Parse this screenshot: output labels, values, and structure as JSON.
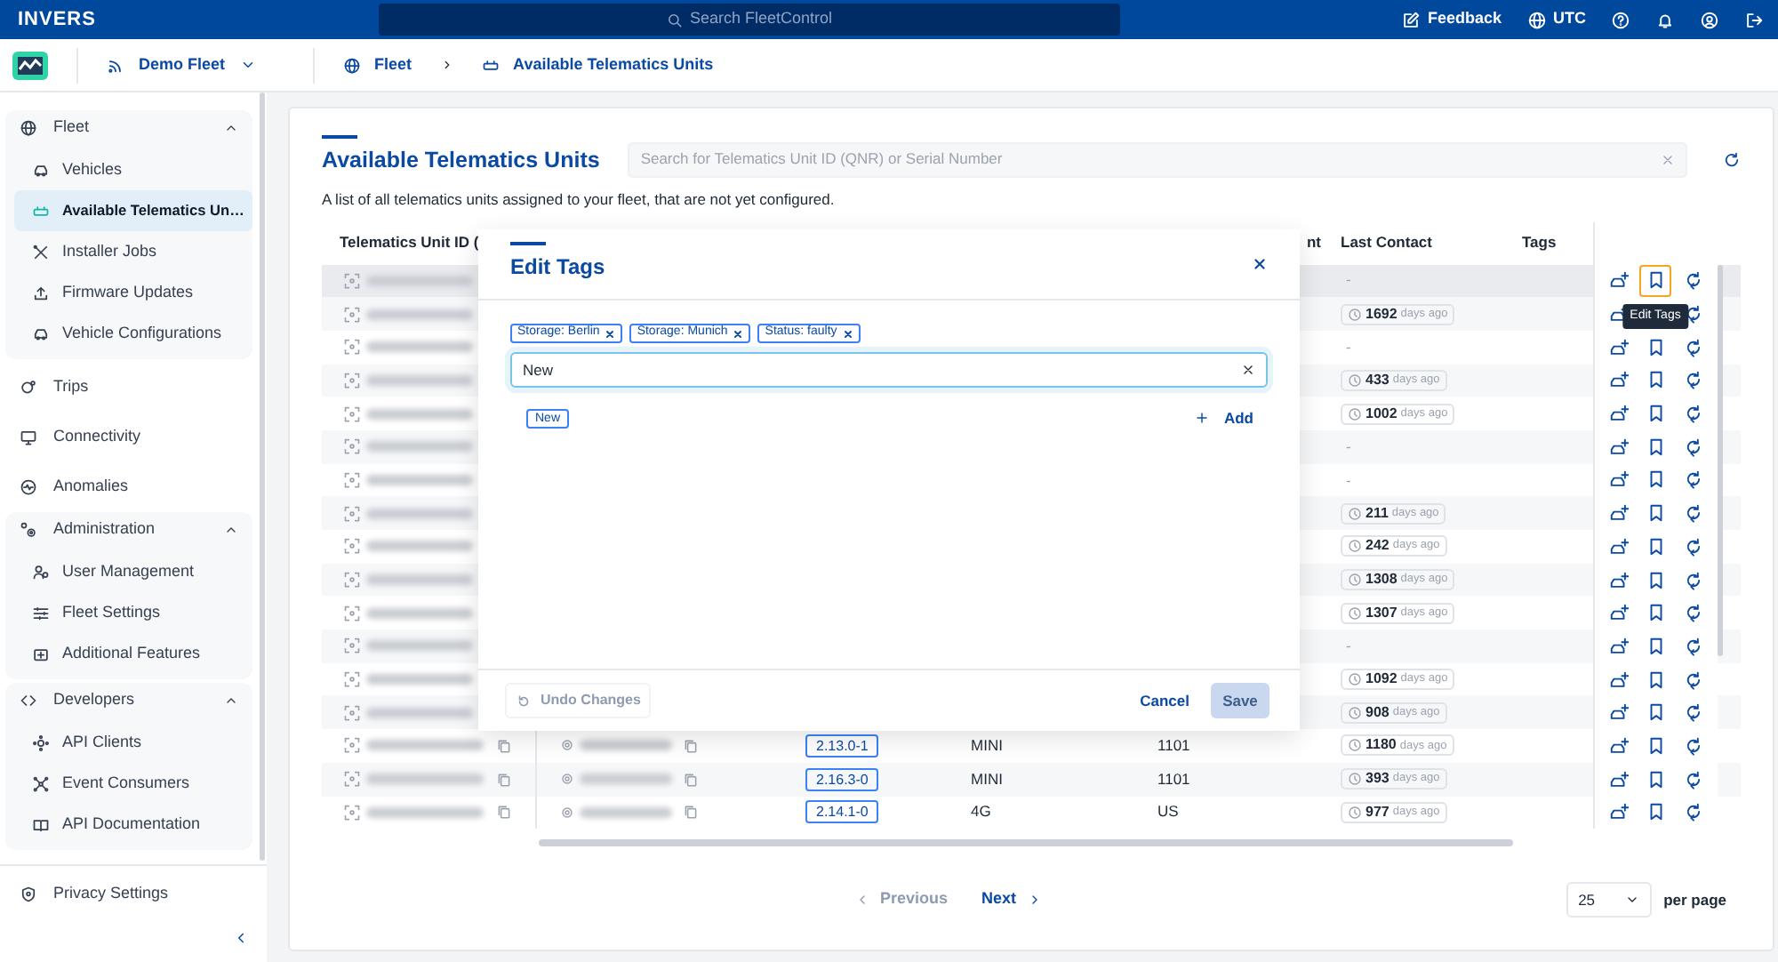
{
  "topbar": {
    "brand": "INVERS",
    "search_placeholder": "Search FleetControl",
    "feedback_label": "Feedback",
    "timezone_label": "UTC"
  },
  "context_bar": {
    "fleet_name": "Demo Fleet",
    "breadcrumbs": [
      "Fleet",
      "Available Telematics Units"
    ]
  },
  "sidebar": {
    "items": [
      {
        "kind": "group",
        "label": "Fleet",
        "expanded": true,
        "children": [
          {
            "label": "Vehicles",
            "selected": false
          },
          {
            "label": "Available Telematics Un…",
            "selected": true
          },
          {
            "label": "Installer Jobs",
            "selected": false
          },
          {
            "label": "Firmware Updates",
            "selected": false
          },
          {
            "label": "Vehicle Configurations",
            "selected": false
          }
        ]
      },
      {
        "kind": "link",
        "label": "Trips",
        "selected": false
      },
      {
        "kind": "link",
        "label": "Connectivity",
        "selected": false
      },
      {
        "kind": "link",
        "label": "Anomalies",
        "selected": false
      },
      {
        "kind": "group",
        "label": "Administration",
        "expanded": true,
        "children": [
          {
            "label": "User Management",
            "selected": false
          },
          {
            "label": "Fleet Settings",
            "selected": false
          },
          {
            "label": "Additional Features",
            "selected": false
          }
        ]
      },
      {
        "kind": "group",
        "label": "Developers",
        "expanded": true,
        "children": [
          {
            "label": "API Clients",
            "selected": false
          },
          {
            "label": "Event Consumers",
            "selected": false
          },
          {
            "label": "API Documentation",
            "selected": false
          }
        ]
      }
    ],
    "footer_item": "Privacy Settings"
  },
  "page": {
    "title": "Available Telematics Units",
    "search_placeholder": "Search for Telematics Unit ID (QNR) or Serial Number",
    "description": "A list of all telematics units assigned to your fleet, that are not yet configured."
  },
  "table": {
    "columns": [
      "Telematics Unit ID (",
      "nt",
      "Last Contact",
      "Tags"
    ],
    "tooltip": "Edit Tags",
    "rows": [
      {
        "hovered": true,
        "action_focused": true,
        "last_contact": {
          "kind": "none",
          "text": "-"
        }
      },
      {
        "hovered": false,
        "action_focused": false,
        "last_contact": {
          "kind": "days",
          "value": "1692",
          "unit": "days ago"
        }
      },
      {
        "hovered": false,
        "action_focused": false,
        "last_contact": {
          "kind": "none",
          "text": "-"
        }
      },
      {
        "hovered": false,
        "action_focused": false,
        "last_contact": {
          "kind": "days",
          "value": "433",
          "unit": "days ago"
        }
      },
      {
        "hovered": false,
        "action_focused": false,
        "last_contact": {
          "kind": "days",
          "value": "1002",
          "unit": "days ago"
        }
      },
      {
        "hovered": false,
        "action_focused": false,
        "last_contact": {
          "kind": "none",
          "text": "-"
        }
      },
      {
        "hovered": false,
        "action_focused": false,
        "last_contact": {
          "kind": "none",
          "text": "-"
        }
      },
      {
        "hovered": false,
        "action_focused": false,
        "last_contact": {
          "kind": "days",
          "value": "211",
          "unit": "days ago"
        }
      },
      {
        "hovered": false,
        "action_focused": false,
        "last_contact": {
          "kind": "days",
          "value": "242",
          "unit": "days ago"
        }
      },
      {
        "hovered": false,
        "action_focused": false,
        "last_contact": {
          "kind": "days",
          "value": "1308",
          "unit": "days ago"
        }
      },
      {
        "hovered": false,
        "action_focused": false,
        "last_contact": {
          "kind": "days",
          "value": "1307",
          "unit": "days ago"
        }
      },
      {
        "hovered": false,
        "action_focused": false,
        "last_contact": {
          "kind": "none",
          "text": "-"
        }
      },
      {
        "hovered": false,
        "action_focused": false,
        "last_contact": {
          "kind": "days",
          "value": "1092",
          "unit": "days ago"
        }
      },
      {
        "hovered": false,
        "action_focused": false,
        "last_contact": {
          "kind": "days",
          "value": "908",
          "unit": "days ago"
        }
      },
      {
        "hovered": false,
        "action_focused": false,
        "firmware": "2.13.0-1",
        "type": "MINI",
        "region": "1101",
        "last_contact": {
          "kind": "days",
          "value": "1180",
          "unit": "days ago"
        }
      },
      {
        "hovered": false,
        "action_focused": false,
        "firmware": "2.16.3-0",
        "type": "MINI",
        "region": "1101",
        "last_contact": {
          "kind": "days",
          "value": "393",
          "unit": "days ago"
        }
      },
      {
        "hovered": false,
        "action_focused": false,
        "firmware": "2.14.1-0",
        "type": "4G",
        "region": "US",
        "last_contact": {
          "kind": "days",
          "value": "977",
          "unit": "days ago"
        }
      }
    ]
  },
  "modal": {
    "title": "Edit Tags",
    "tags": [
      "Storage: Berlin",
      "Storage: Munich",
      "Status: faulty"
    ],
    "input_value": "New",
    "suggestions": [
      "New"
    ],
    "add_label": "Add",
    "undo_label": "Undo Changes",
    "undo_disabled": true,
    "cancel_label": "Cancel",
    "save_label": "Save",
    "save_disabled": true
  },
  "pagination": {
    "previous_label": "Previous",
    "previous_disabled": true,
    "next_label": "Next",
    "next_disabled": false,
    "page_size": "25",
    "per_page_label": "per page"
  }
}
